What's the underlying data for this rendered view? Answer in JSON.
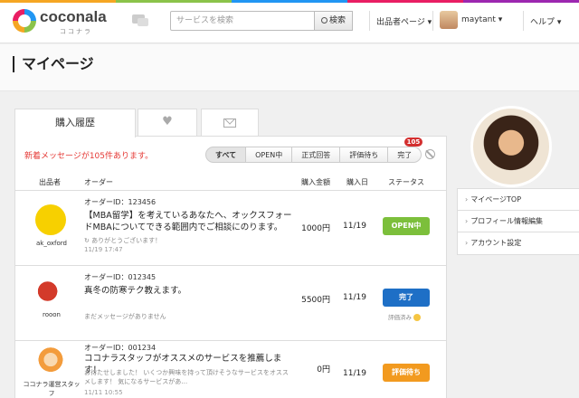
{
  "header": {
    "logo": "coconala",
    "logo_sub": "ココナラ",
    "search_placeholder": "サービスを検索",
    "search_button": "検索",
    "seller_page": "出品者ページ ▾",
    "username": "maytant ▾",
    "help": "ヘルプ ▾"
  },
  "page": {
    "title": "マイページ"
  },
  "tabs": {
    "history": "購入履歴"
  },
  "notice": "新着メッセージが105件あります。",
  "filters": [
    {
      "label": "すべて"
    },
    {
      "label": "OPEN中"
    },
    {
      "label": "正式回答"
    },
    {
      "label": "評価待ち"
    },
    {
      "label": "完了",
      "badge": "105"
    }
  ],
  "table_headers": [
    "出品者",
    "オーダー",
    "購入金額",
    "購入日",
    "ステータス"
  ],
  "orders": [
    {
      "seller": "ak_oxford",
      "order_id": "オーダーID：123456",
      "title": "【MBA留学】を考えているあなたへ、オックスフォードMBAについてできる範囲内でご相談にのります。",
      "message": "ありがとうございます！",
      "time": "11/19 17:47",
      "amount": "1000円",
      "date": "11/19",
      "status": "OPEN中",
      "status_color": "#7cbf3b",
      "avatar_color": "#f7d000"
    },
    {
      "seller": "rooon",
      "order_id": "オーダーID：012345",
      "title": "真冬の防寒テク教えます。",
      "message": "まだメッセージがありません",
      "time": "",
      "amount": "5500円",
      "date": "11/19",
      "status": "完了",
      "status_color": "#1e6fc6",
      "eval_note": "評価済み",
      "avatar_color": "#d33a2a"
    },
    {
      "seller": "ココナラ運営スタッフ",
      "order_id": "オーダーID：001234",
      "title": "ココナラスタッフがオススメのサービスを推薦します！",
      "message": "お待たせしました！ いくつか興味を持って頂けそうなサービスをオススメします！ 気になるサービスがあ…",
      "time": "11/11 10:55",
      "amount": "0円",
      "date": "11/19",
      "status": "評価待ち",
      "status_color": "#f29a1f",
      "avatar_color": "#f39c3c"
    }
  ],
  "sidebar": {
    "items": [
      "マイページTOP",
      "プロフィール情報編集",
      "アカウント設定"
    ]
  }
}
